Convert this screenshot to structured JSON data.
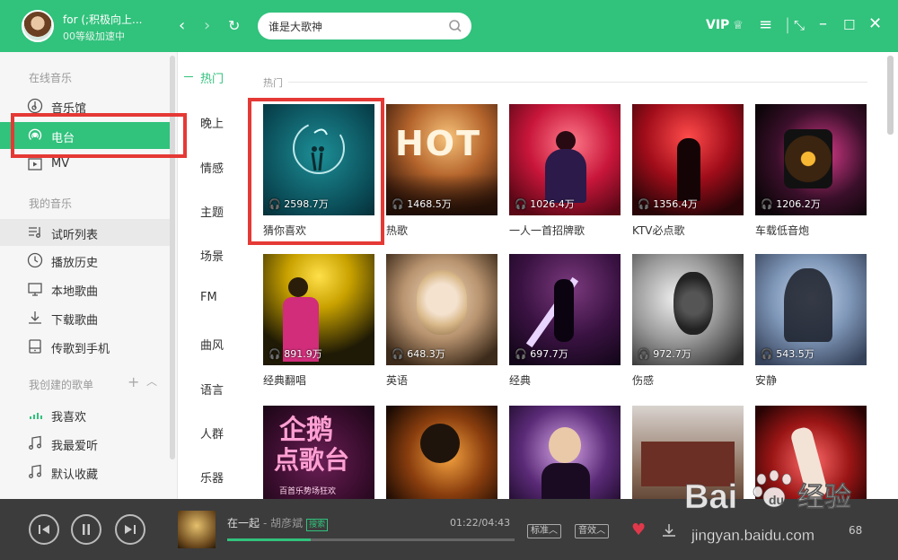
{
  "user": {
    "name": "for (;积极向上...",
    "level": "00等级加速中"
  },
  "search": {
    "value": "谁是大歌神"
  },
  "window": {
    "vip": "VIP"
  },
  "sidebar": {
    "online_title": "在线音乐",
    "online_items": [
      "音乐馆",
      "电台",
      "MV"
    ],
    "my_title": "我的音乐",
    "my_items": [
      "试听列表",
      "播放历史",
      "本地歌曲",
      "下载歌曲",
      "传歌到手机"
    ],
    "created_title": "我创建的歌单",
    "created_items": [
      "我喜欢",
      "我最爱听",
      "默认收藏"
    ]
  },
  "categories": [
    "热门",
    "晚上",
    "情感",
    "主题",
    "场景",
    "FM",
    "曲风",
    "语言",
    "人群",
    "乐器"
  ],
  "section_title": "热门",
  "stations": [
    {
      "name": "猜你喜欢",
      "count": "2598.7万"
    },
    {
      "name": "热歌",
      "count": "1468.5万"
    },
    {
      "name": "一人一首招牌歌",
      "count": "1026.4万"
    },
    {
      "name": "KTV必点歌",
      "count": "1356.4万"
    },
    {
      "name": "车载低音炮",
      "count": "1206.2万"
    },
    {
      "name": "经典翻唱",
      "count": "891.9万"
    },
    {
      "name": "英语",
      "count": "648.3万"
    },
    {
      "name": "经典",
      "count": "697.7万"
    },
    {
      "name": "伤感",
      "count": "972.7万"
    },
    {
      "name": "安静",
      "count": "543.5万"
    },
    {
      "name": "",
      "count": ""
    },
    {
      "name": "",
      "count": ""
    },
    {
      "name": "",
      "count": ""
    },
    {
      "name": "",
      "count": ""
    },
    {
      "name": "",
      "count": ""
    }
  ],
  "cover_texts": {
    "hot": "HOT",
    "kpop_line1": "企鹅",
    "kpop_line2": "点歌台",
    "kpop_sub": "百首乐势场狂欢"
  },
  "player": {
    "song": "在一起",
    "singer": "- 胡彦斌",
    "badge": "搜索",
    "time": "01:22/04:43",
    "progress": 0.29,
    "quality": "标准",
    "effect": "音效",
    "right_count": "68"
  },
  "watermark": {
    "brand": "Bai",
    "paw": "du",
    "cn": "经验",
    "url": "jingyan.baidu.com"
  },
  "colors": {
    "accent": "#31c27c",
    "highlight": "#e53935",
    "player_bg": "#3c3c3c"
  }
}
